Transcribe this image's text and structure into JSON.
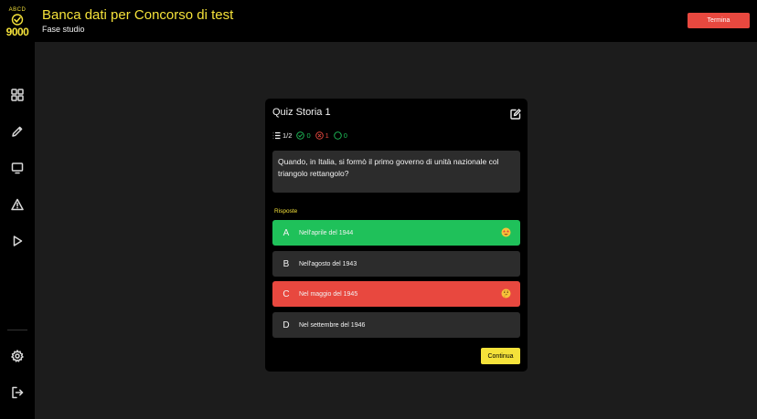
{
  "app": {
    "logo_top": "ABCD",
    "logo_bottom": "9000",
    "title": "Banca dati per Concorso di test",
    "subtitle": "Fase studio",
    "end_button": "Termina"
  },
  "sidebar": {
    "items": [
      {
        "name": "dashboard",
        "icon": "grid-icon"
      },
      {
        "name": "edit",
        "icon": "pencil-icon"
      },
      {
        "name": "screen",
        "icon": "monitor-icon"
      },
      {
        "name": "warnings",
        "icon": "warning-icon"
      },
      {
        "name": "play",
        "icon": "play-icon"
      }
    ],
    "bottom_items": [
      {
        "name": "settings",
        "icon": "gear-icon"
      },
      {
        "name": "logout",
        "icon": "logout-icon"
      }
    ]
  },
  "quiz": {
    "title": "Quiz Storia 1",
    "progress": "1/2",
    "correct_count": "0",
    "wrong_count": "1",
    "unanswered_count": "0",
    "question": "Quando, in Italia, si formò il primo governo di unità nazionale col triangolo rettangolo?",
    "answers_label": "Risposte",
    "answers": [
      {
        "letter": "A",
        "text": "Nell'aprile del 1944",
        "state": "correct",
        "emoji": "star-eyes-emoji"
      },
      {
        "letter": "B",
        "text": "Nell'agosto del 1943",
        "state": "neutral"
      },
      {
        "letter": "C",
        "text": "Nel maggio del 1945",
        "state": "wrong",
        "emoji": "thinking-emoji"
      },
      {
        "letter": "D",
        "text": "Nel settembre del 1946",
        "state": "neutral"
      }
    ],
    "continue_button": "Continua"
  },
  "colors": {
    "accent": "#f5e23a",
    "correct": "#1fc15a",
    "wrong": "#e8483f",
    "surface": "#2c2c2c",
    "background": "#1c1c1c"
  }
}
